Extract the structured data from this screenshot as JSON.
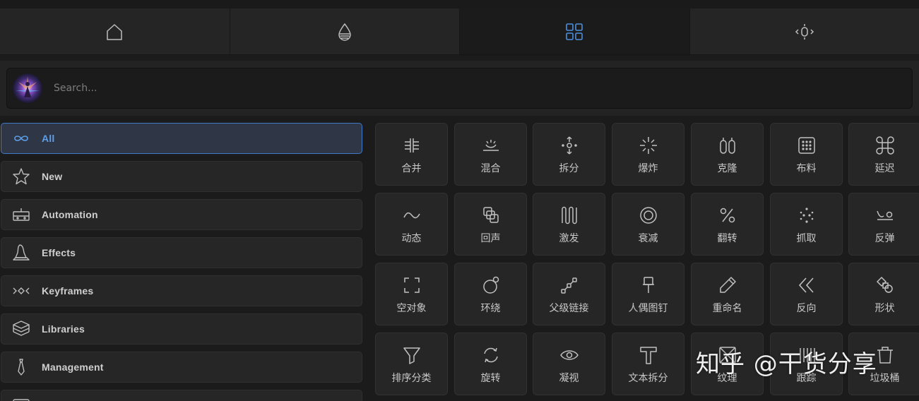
{
  "tabs": [
    {
      "icon": "home-icon"
    },
    {
      "icon": "droplet-icon"
    },
    {
      "icon": "grid-icon",
      "active": true
    },
    {
      "icon": "keyframe-icon"
    }
  ],
  "search": {
    "placeholder": "Search..."
  },
  "sidebar": {
    "items": [
      {
        "label": "All",
        "icon": "infinity-icon",
        "active": true
      },
      {
        "label": "New",
        "icon": "star-icon"
      },
      {
        "label": "Automation",
        "icon": "robot-icon"
      },
      {
        "label": "Effects",
        "icon": "wizard-hat-icon"
      },
      {
        "label": "Keyframes",
        "icon": "keyframes-icon"
      },
      {
        "label": "Libraries",
        "icon": "cube-stack-icon"
      },
      {
        "label": "Management",
        "icon": "tie-icon"
      },
      {
        "label": "",
        "icon": "folder-icon"
      }
    ]
  },
  "grid": {
    "rows": [
      [
        {
          "label": "合并",
          "icon": "merge-icon"
        },
        {
          "label": "混合",
          "icon": "blend-icon"
        },
        {
          "label": "拆分",
          "icon": "split-icon"
        },
        {
          "label": "爆炸",
          "icon": "explode-icon"
        },
        {
          "label": "克隆",
          "icon": "clone-icon"
        },
        {
          "label": "布料",
          "icon": "cloth-icon"
        },
        {
          "label": "延迟",
          "icon": "command-icon"
        }
      ],
      [
        {
          "label": "动态",
          "icon": "wave-icon"
        },
        {
          "label": "回声",
          "icon": "echo-icon"
        },
        {
          "label": "激发",
          "icon": "excite-icon"
        },
        {
          "label": "衰减",
          "icon": "decay-icon"
        },
        {
          "label": "翻转",
          "icon": "percent-icon"
        },
        {
          "label": "抓取",
          "icon": "grab-icon"
        },
        {
          "label": "反弹",
          "icon": "bounce-icon"
        }
      ],
      [
        {
          "label": "空对象",
          "icon": "null-object-icon"
        },
        {
          "label": "环绕",
          "icon": "orbit-icon"
        },
        {
          "label": "父级链接",
          "icon": "parent-link-icon"
        },
        {
          "label": "人偶图钉",
          "icon": "pin-icon"
        },
        {
          "label": "重命名",
          "icon": "pencil-icon"
        },
        {
          "label": "反向",
          "icon": "reverse-icon"
        },
        {
          "label": "形状",
          "icon": "shapes-icon"
        }
      ],
      [
        {
          "label": "排序分类",
          "icon": "filter-icon"
        },
        {
          "label": "旋转",
          "icon": "rotate-icon"
        },
        {
          "label": "凝视",
          "icon": "eye-icon"
        },
        {
          "label": "文本拆分",
          "icon": "text-icon"
        },
        {
          "label": "纹理",
          "icon": "texture-icon"
        },
        {
          "label": "跟踪",
          "icon": "track-icon"
        },
        {
          "label": "垃圾桶",
          "icon": "trash-icon"
        }
      ]
    ]
  },
  "watermark": {
    "text": "知乎 @干货分享"
  },
  "colors": {
    "accent": "#3f7ac8",
    "accent_text": "#5d9ee8",
    "background": "#1b1b1b",
    "panel": "#262626"
  }
}
